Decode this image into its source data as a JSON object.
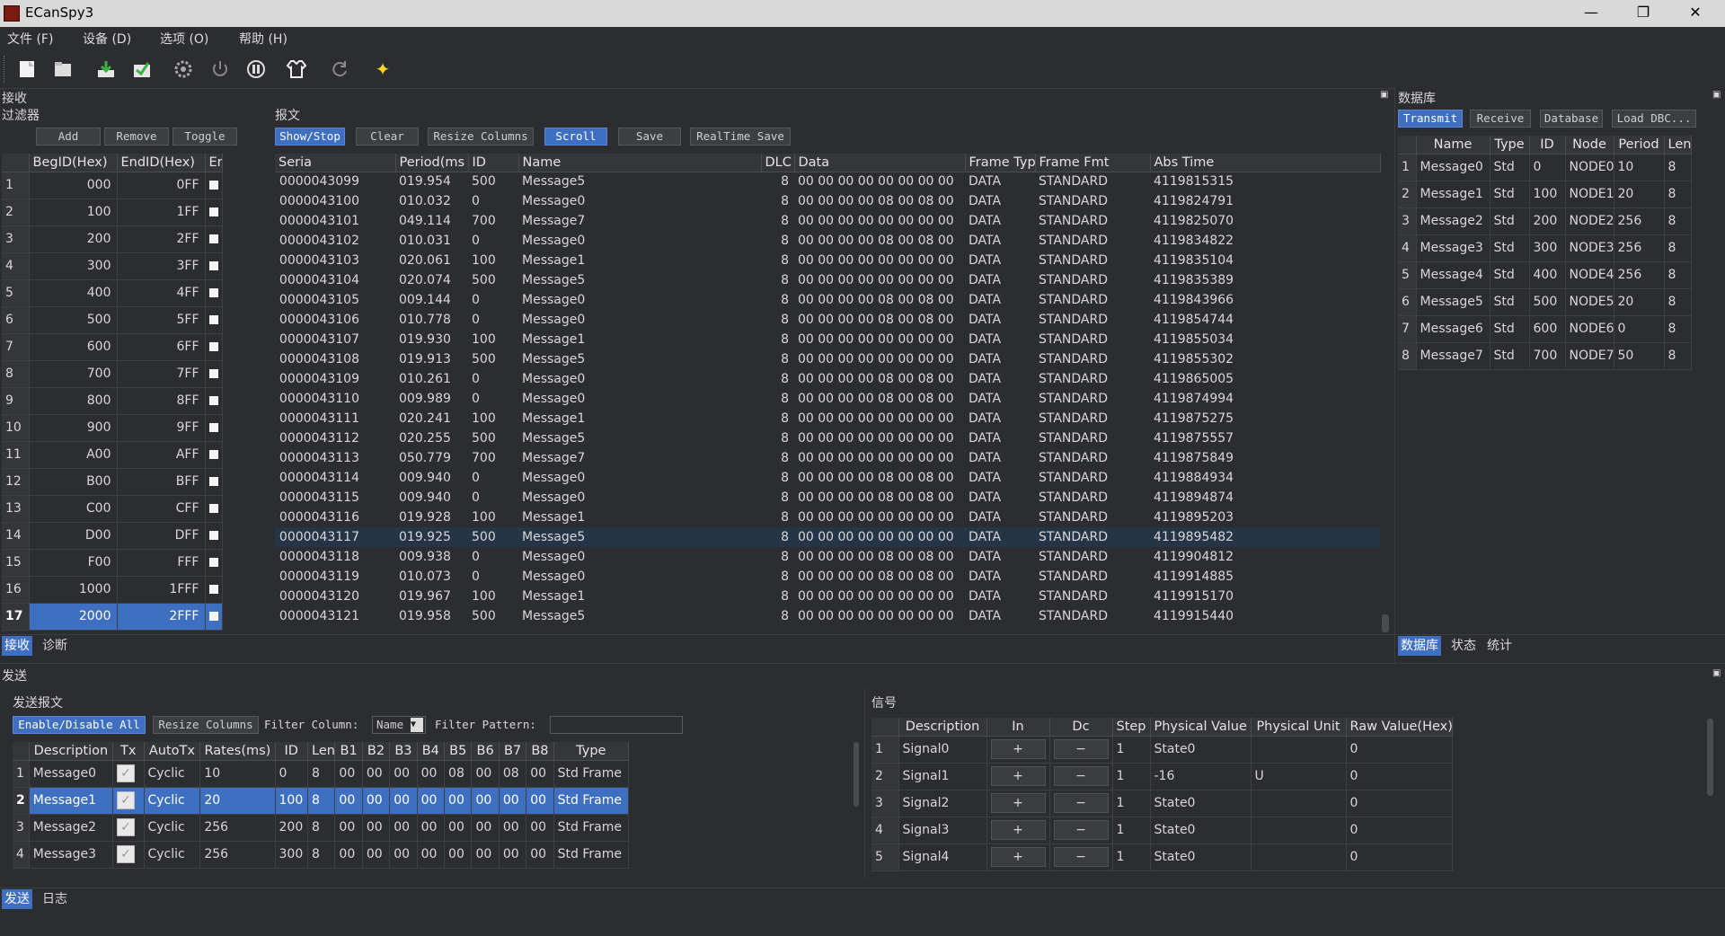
{
  "window": {
    "title": "ECanSpy3",
    "minimize": "—",
    "restore": "❐",
    "close": "✕"
  },
  "menu": [
    "文件 (F)",
    "设备 (D)",
    "选项 (O)",
    "帮助 (H)"
  ],
  "toolbar": {
    "icons": [
      "new-file-icon",
      "open-folder-icon",
      "download-icon",
      "export-icon",
      "settings-gear-icon",
      "power-icon",
      "pause-icon",
      "shirt-icon",
      "refresh-icon",
      "star-icon"
    ]
  },
  "receive": {
    "title": "接收",
    "filter": {
      "title": "过滤器",
      "buttons": [
        "Add",
        "Remove",
        "Toggle"
      ],
      "headers": [
        "BegID(Hex)",
        "EndID(Hex)",
        "En"
      ],
      "rows": [
        [
          "1",
          "000",
          "0FF"
        ],
        [
          "2",
          "100",
          "1FF"
        ],
        [
          "3",
          "200",
          "2FF"
        ],
        [
          "4",
          "300",
          "3FF"
        ],
        [
          "5",
          "400",
          "4FF"
        ],
        [
          "6",
          "500",
          "5FF"
        ],
        [
          "7",
          "600",
          "6FF"
        ],
        [
          "8",
          "700",
          "7FF"
        ],
        [
          "9",
          "800",
          "8FF"
        ],
        [
          "10",
          "900",
          "9FF"
        ],
        [
          "11",
          "A00",
          "AFF"
        ],
        [
          "12",
          "B00",
          "BFF"
        ],
        [
          "13",
          "C00",
          "CFF"
        ],
        [
          "14",
          "D00",
          "DFF"
        ],
        [
          "15",
          "F00",
          "FFF"
        ],
        [
          "16",
          "1000",
          "1FFF"
        ],
        [
          "17",
          "2000",
          "2FFF"
        ]
      ],
      "selected_row": 16
    },
    "messages": {
      "title": "报文",
      "buttons": [
        "Show/Stop",
        "Clear",
        "Resize Columns",
        "Scroll",
        "Save",
        "RealTime Save"
      ],
      "headers": [
        "Seria",
        "Period(ms",
        "ID",
        "Name",
        "DLC",
        "Data",
        "Frame Typ",
        "Frame Fmt",
        "Abs Time"
      ],
      "rows": [
        [
          "0000043099",
          "019.954",
          "500",
          "Message5",
          "8",
          "00 00 00 00 00 00 00 00",
          "DATA",
          "STANDARD",
          "4119815315"
        ],
        [
          "0000043100",
          "010.032",
          "0",
          "Message0",
          "8",
          "00 00 00 00 08 00 08 00",
          "DATA",
          "STANDARD",
          "4119824791"
        ],
        [
          "0000043101",
          "049.114",
          "700",
          "Message7",
          "8",
          "00 00 00 00 00 00 00 00",
          "DATA",
          "STANDARD",
          "4119825070"
        ],
        [
          "0000043102",
          "010.031",
          "0",
          "Message0",
          "8",
          "00 00 00 00 08 00 08 00",
          "DATA",
          "STANDARD",
          "4119834822"
        ],
        [
          "0000043103",
          "020.061",
          "100",
          "Message1",
          "8",
          "00 00 00 00 00 00 00 00",
          "DATA",
          "STANDARD",
          "4119835104"
        ],
        [
          "0000043104",
          "020.074",
          "500",
          "Message5",
          "8",
          "00 00 00 00 00 00 00 00",
          "DATA",
          "STANDARD",
          "4119835389"
        ],
        [
          "0000043105",
          "009.144",
          "0",
          "Message0",
          "8",
          "00 00 00 00 08 00 08 00",
          "DATA",
          "STANDARD",
          "4119843966"
        ],
        [
          "0000043106",
          "010.778",
          "0",
          "Message0",
          "8",
          "00 00 00 00 08 00 08 00",
          "DATA",
          "STANDARD",
          "4119854744"
        ],
        [
          "0000043107",
          "019.930",
          "100",
          "Message1",
          "8",
          "00 00 00 00 00 00 00 00",
          "DATA",
          "STANDARD",
          "4119855034"
        ],
        [
          "0000043108",
          "019.913",
          "500",
          "Message5",
          "8",
          "00 00 00 00 00 00 00 00",
          "DATA",
          "STANDARD",
          "4119855302"
        ],
        [
          "0000043109",
          "010.261",
          "0",
          "Message0",
          "8",
          "00 00 00 00 08 00 08 00",
          "DATA",
          "STANDARD",
          "4119865005"
        ],
        [
          "0000043110",
          "009.989",
          "0",
          "Message0",
          "8",
          "00 00 00 00 08 00 08 00",
          "DATA",
          "STANDARD",
          "4119874994"
        ],
        [
          "0000043111",
          "020.241",
          "100",
          "Message1",
          "8",
          "00 00 00 00 00 00 00 00",
          "DATA",
          "STANDARD",
          "4119875275"
        ],
        [
          "0000043112",
          "020.255",
          "500",
          "Message5",
          "8",
          "00 00 00 00 00 00 00 00",
          "DATA",
          "STANDARD",
          "4119875557"
        ],
        [
          "0000043113",
          "050.779",
          "700",
          "Message7",
          "8",
          "00 00 00 00 00 00 00 00",
          "DATA",
          "STANDARD",
          "4119875849"
        ],
        [
          "0000043114",
          "009.940",
          "0",
          "Message0",
          "8",
          "00 00 00 00 08 00 08 00",
          "DATA",
          "STANDARD",
          "4119884934"
        ],
        [
          "0000043115",
          "009.940",
          "0",
          "Message0",
          "8",
          "00 00 00 00 08 00 08 00",
          "DATA",
          "STANDARD",
          "4119894874"
        ],
        [
          "0000043116",
          "019.928",
          "100",
          "Message1",
          "8",
          "00 00 00 00 00 00 00 00",
          "DATA",
          "STANDARD",
          "4119895203"
        ],
        [
          "0000043117",
          "019.925",
          "500",
          "Message5",
          "8",
          "00 00 00 00 00 00 00 00",
          "DATA",
          "STANDARD",
          "4119895482"
        ],
        [
          "0000043118",
          "009.938",
          "0",
          "Message0",
          "8",
          "00 00 00 00 08 00 08 00",
          "DATA",
          "STANDARD",
          "4119904812"
        ],
        [
          "0000043119",
          "010.073",
          "0",
          "Message0",
          "8",
          "00 00 00 00 08 00 08 00",
          "DATA",
          "STANDARD",
          "4119914885"
        ],
        [
          "0000043120",
          "019.967",
          "100",
          "Message1",
          "8",
          "00 00 00 00 00 00 00 00",
          "DATA",
          "STANDARD",
          "4119915170"
        ],
        [
          "0000043121",
          "019.958",
          "500",
          "Message5",
          "8",
          "00 00 00 00 00 00 00 00",
          "DATA",
          "STANDARD",
          "4119915440"
        ]
      ],
      "highlight_row": 18
    },
    "tabs": [
      "接收",
      "诊断"
    ]
  },
  "database": {
    "title": "数据库",
    "buttons": [
      "Transmit",
      "Receive",
      "Database",
      "Load DBC..."
    ],
    "headers": [
      "Name",
      "Type",
      "ID",
      "Node",
      "Period",
      "Len"
    ],
    "rows": [
      [
        "1",
        "Message0",
        "Std",
        "0",
        "NODE0",
        "10",
        "8"
      ],
      [
        "2",
        "Message1",
        "Std",
        "100",
        "NODE1",
        "20",
        "8"
      ],
      [
        "3",
        "Message2",
        "Std",
        "200",
        "NODE2",
        "256",
        "8"
      ],
      [
        "4",
        "Message3",
        "Std",
        "300",
        "NODE3",
        "256",
        "8"
      ],
      [
        "5",
        "Message4",
        "Std",
        "400",
        "NODE4",
        "256",
        "8"
      ],
      [
        "6",
        "Message5",
        "Std",
        "500",
        "NODE5",
        "20",
        "8"
      ],
      [
        "7",
        "Message6",
        "Std",
        "600",
        "NODE6",
        "0",
        "8"
      ],
      [
        "8",
        "Message7",
        "Std",
        "700",
        "NODE7",
        "50",
        "8"
      ]
    ],
    "tabs": [
      "数据库",
      "状态",
      "统计"
    ]
  },
  "send": {
    "title": "发送",
    "messages": {
      "title": "发送报文",
      "buttons": [
        "Enable/Disable All",
        "Resize Columns"
      ],
      "filter_column_label": "Filter Column:",
      "filter_column_value": "Name",
      "filter_pattern_label": "Filter Pattern:",
      "filter_pattern_value": "",
      "headers": [
        "Description",
        "Tx",
        "AutoTx",
        "Rates(ms)",
        "ID",
        "Len",
        "B1",
        "B2",
        "B3",
        "B4",
        "B5",
        "B6",
        "B7",
        "B8",
        "Type"
      ],
      "rows": [
        [
          "1",
          "Message0",
          "✓",
          "Cyclic",
          "10",
          "0",
          "8",
          "00",
          "00",
          "00",
          "00",
          "08",
          "00",
          "08",
          "00",
          "Std Frame"
        ],
        [
          "2",
          "Message1",
          "✓",
          "Cyclic",
          "20",
          "100",
          "8",
          "00",
          "00",
          "00",
          "00",
          "00",
          "00",
          "00",
          "00",
          "Std Frame"
        ],
        [
          "3",
          "Message2",
          "✓",
          "Cyclic",
          "256",
          "200",
          "8",
          "00",
          "00",
          "00",
          "00",
          "00",
          "00",
          "00",
          "00",
          "Std Frame"
        ],
        [
          "4",
          "Message3",
          "✓",
          "Cyclic",
          "256",
          "300",
          "8",
          "00",
          "00",
          "00",
          "00",
          "00",
          "00",
          "00",
          "00",
          "Std Frame"
        ]
      ],
      "selected_row": 1
    },
    "signals": {
      "title": "信号",
      "headers": [
        "Description",
        "In",
        "Dc",
        "Step",
        "Physical Value",
        "Physical Unit",
        "Raw Value(Hex)"
      ],
      "rows": [
        [
          "1",
          "Signal0",
          "+",
          "−",
          "1",
          "State0",
          "",
          "0"
        ],
        [
          "2",
          "Signal1",
          "+",
          "−",
          "1",
          "-16",
          "U",
          "0"
        ],
        [
          "3",
          "Signal2",
          "+",
          "−",
          "1",
          "State0",
          "",
          "0"
        ],
        [
          "4",
          "Signal3",
          "+",
          "−",
          "1",
          "State0",
          "",
          "0"
        ],
        [
          "5",
          "Signal4",
          "+",
          "−",
          "1",
          "State0",
          "",
          "0"
        ]
      ]
    },
    "tabs": [
      "发送",
      "日志"
    ]
  }
}
